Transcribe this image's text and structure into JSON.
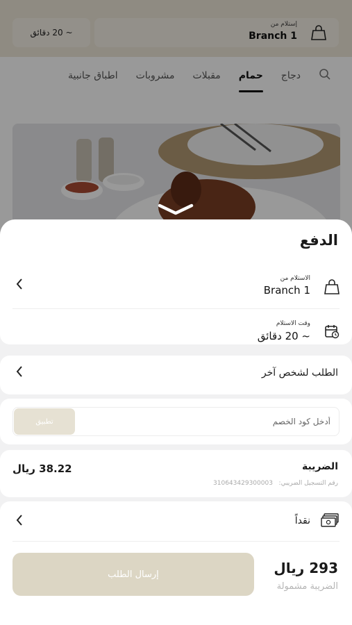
{
  "background": {
    "eta": "~ 20 دقائق",
    "pickup_from_label": "إستلام من",
    "branch_name": "Branch 1",
    "tabs": [
      "دجاج",
      "حمام",
      "مقبلات",
      "مشروبات",
      "اطباق جانبية"
    ],
    "active_tab": "حمام"
  },
  "sheet": {
    "title": "الدفع",
    "pickup": {
      "label": "الاستلام من",
      "value": "Branch 1"
    },
    "pickup_time": {
      "label": "وقت الاستلام",
      "value": "~ 20 دقائق"
    },
    "order_for_other": "الطلب لشخص آخر",
    "coupon": {
      "placeholder": "أدخل كود الخصم",
      "apply_label": "تطبيق"
    },
    "tax": {
      "label": "الضريبة",
      "registration_label": "رقم التسجيل الضريبي:",
      "registration_number": "310643429300003",
      "amount": "38.22 ريال"
    },
    "payment_method": "نقداً",
    "total": {
      "amount": "293 ريال",
      "note": "الضريبة مشمولة"
    },
    "submit_label": "إرسال الطلب"
  },
  "colors": {
    "accent": "#dcd6c4",
    "header_bg": "#efe8d9",
    "sheet_bg": "#f1f1f2"
  }
}
